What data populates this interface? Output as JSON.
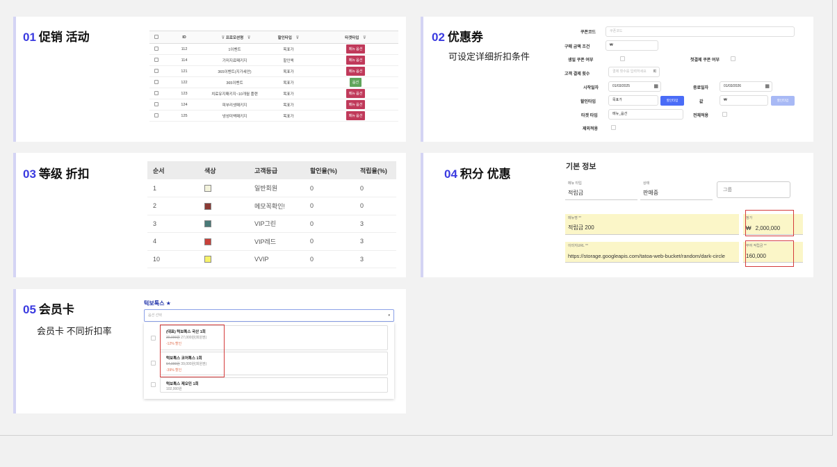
{
  "cards": {
    "promo": {
      "num": "01",
      "title": "促销 活动",
      "columns": [
        "ID",
        "프로모션명",
        "할인타입",
        "타겟타입"
      ],
      "rows": [
        {
          "id": "112",
          "name": "1이벤트",
          "type": "목표가",
          "tag": "메뉴 옵션",
          "tag_color": "red"
        },
        {
          "id": "114",
          "name": "기미지료패키지",
          "type": "할인액",
          "tag": "메뉴 옵션",
          "tag_color": "red"
        },
        {
          "id": "121",
          "name": "365이벤트(지가세안)",
          "type": "목표가",
          "tag": "메뉴 옵션",
          "tag_color": "red"
        },
        {
          "id": "122",
          "name": "365이벤트",
          "type": "목표가",
          "tag": "옵션",
          "tag_color": "green"
        },
        {
          "id": "123",
          "name": "치료유지패키지~10개월 플랜",
          "type": "목표가",
          "tag": "메뉴 옵션",
          "tag_color": "red"
        },
        {
          "id": "124",
          "name": "피부리셋패키지",
          "type": "목표가",
          "tag": "메뉴 옵션",
          "tag_color": "red"
        },
        {
          "id": "125",
          "name": "냉성미백패키지",
          "type": "목표가",
          "tag": "메뉴 옵션",
          "tag_color": "red"
        }
      ]
    },
    "coupon": {
      "num": "02",
      "title": "优惠券",
      "subtitle": "可设定详细折扣条件",
      "labels": {
        "code": "쿠폰코드",
        "min_amount": "구매 금액 조건",
        "birthday": "생일 쿠폰 여부",
        "first_pay": "첫결제 쿠폰 여부",
        "pay_count": "고객 결제 횟수",
        "start": "시작일자",
        "end": "종료일자",
        "disc_type": "할인타입",
        "value": "값",
        "target": "타겟 타입",
        "apply_all": "전체적용",
        "exclude": "제외적용"
      },
      "values": {
        "code_ph": "쿠폰코드",
        "min_amount": "₩",
        "pay_count_ph": "결제 횟수를 입력하세요",
        "pay_count_unit": "회",
        "start": "01/03/2025",
        "end": "01/03/2026",
        "disc_type": "목표가",
        "value": "₩",
        "target": "메뉴_옵션",
        "btn1": "할인타입",
        "btn2": "할인타입"
      }
    },
    "grade": {
      "num": "03",
      "title": "等级 折扣",
      "columns": [
        "순서",
        "색상",
        "고객등급",
        "할인율(%)",
        "적립율(%)"
      ],
      "rows": [
        {
          "order": "1",
          "color": "#f3f3dc",
          "grade": "일반회원",
          "disc": "0",
          "point": "0"
        },
        {
          "order": "2",
          "color": "#8b3a34",
          "grade": "메모꼭확인!",
          "disc": "0",
          "point": "0"
        },
        {
          "order": "3",
          "color": "#4a7a78",
          "grade": "VIP그린",
          "disc": "0",
          "point": "3"
        },
        {
          "order": "4",
          "color": "#c8413a",
          "grade": "VIP레드",
          "disc": "0",
          "point": "3"
        },
        {
          "order": "10",
          "color": "#f6f26a",
          "grade": "VVIP",
          "disc": "0",
          "point": "3"
        }
      ]
    },
    "points": {
      "num": "04",
      "title": "积分 优惠",
      "section": "기본 정보",
      "menu_type_label": "메뉴 타입",
      "menu_type": "적립금",
      "status_label": "상태",
      "status": "판매중",
      "group_ph": "그룹",
      "menu_name_label": "메뉴명 **",
      "menu_name": "적립금 200",
      "price_label": "정가",
      "price_cur": "₩",
      "price": "2,000,000",
      "image_label": "이미지URL **",
      "image_url": "https://storage.googleapis.com/tatoa-web-bucket/random/dark-circle",
      "bonus_label": "부여 적립금 **",
      "bonus": "160,000"
    },
    "member": {
      "num": "05",
      "title": "会员卡",
      "subtitle": "会员卡 不同折扣率",
      "field_label": "턱보톡스",
      "placeholder": "옵션 선택",
      "options": [
        {
          "name": "(대표) 턱보톡스 국산 1회",
          "orig": "30,000원",
          "price": "27,000원(회원권)",
          "tag": "-12% 할인"
        },
        {
          "name": "턱보톡스 코어톡스 1회",
          "orig": "64,000원",
          "price": "39,000원(회원권)",
          "tag": "-39% 할인"
        },
        {
          "name": "턱보톡스 제오민 1회",
          "orig": "",
          "price": "102,000원",
          "tag": ""
        }
      ]
    }
  }
}
